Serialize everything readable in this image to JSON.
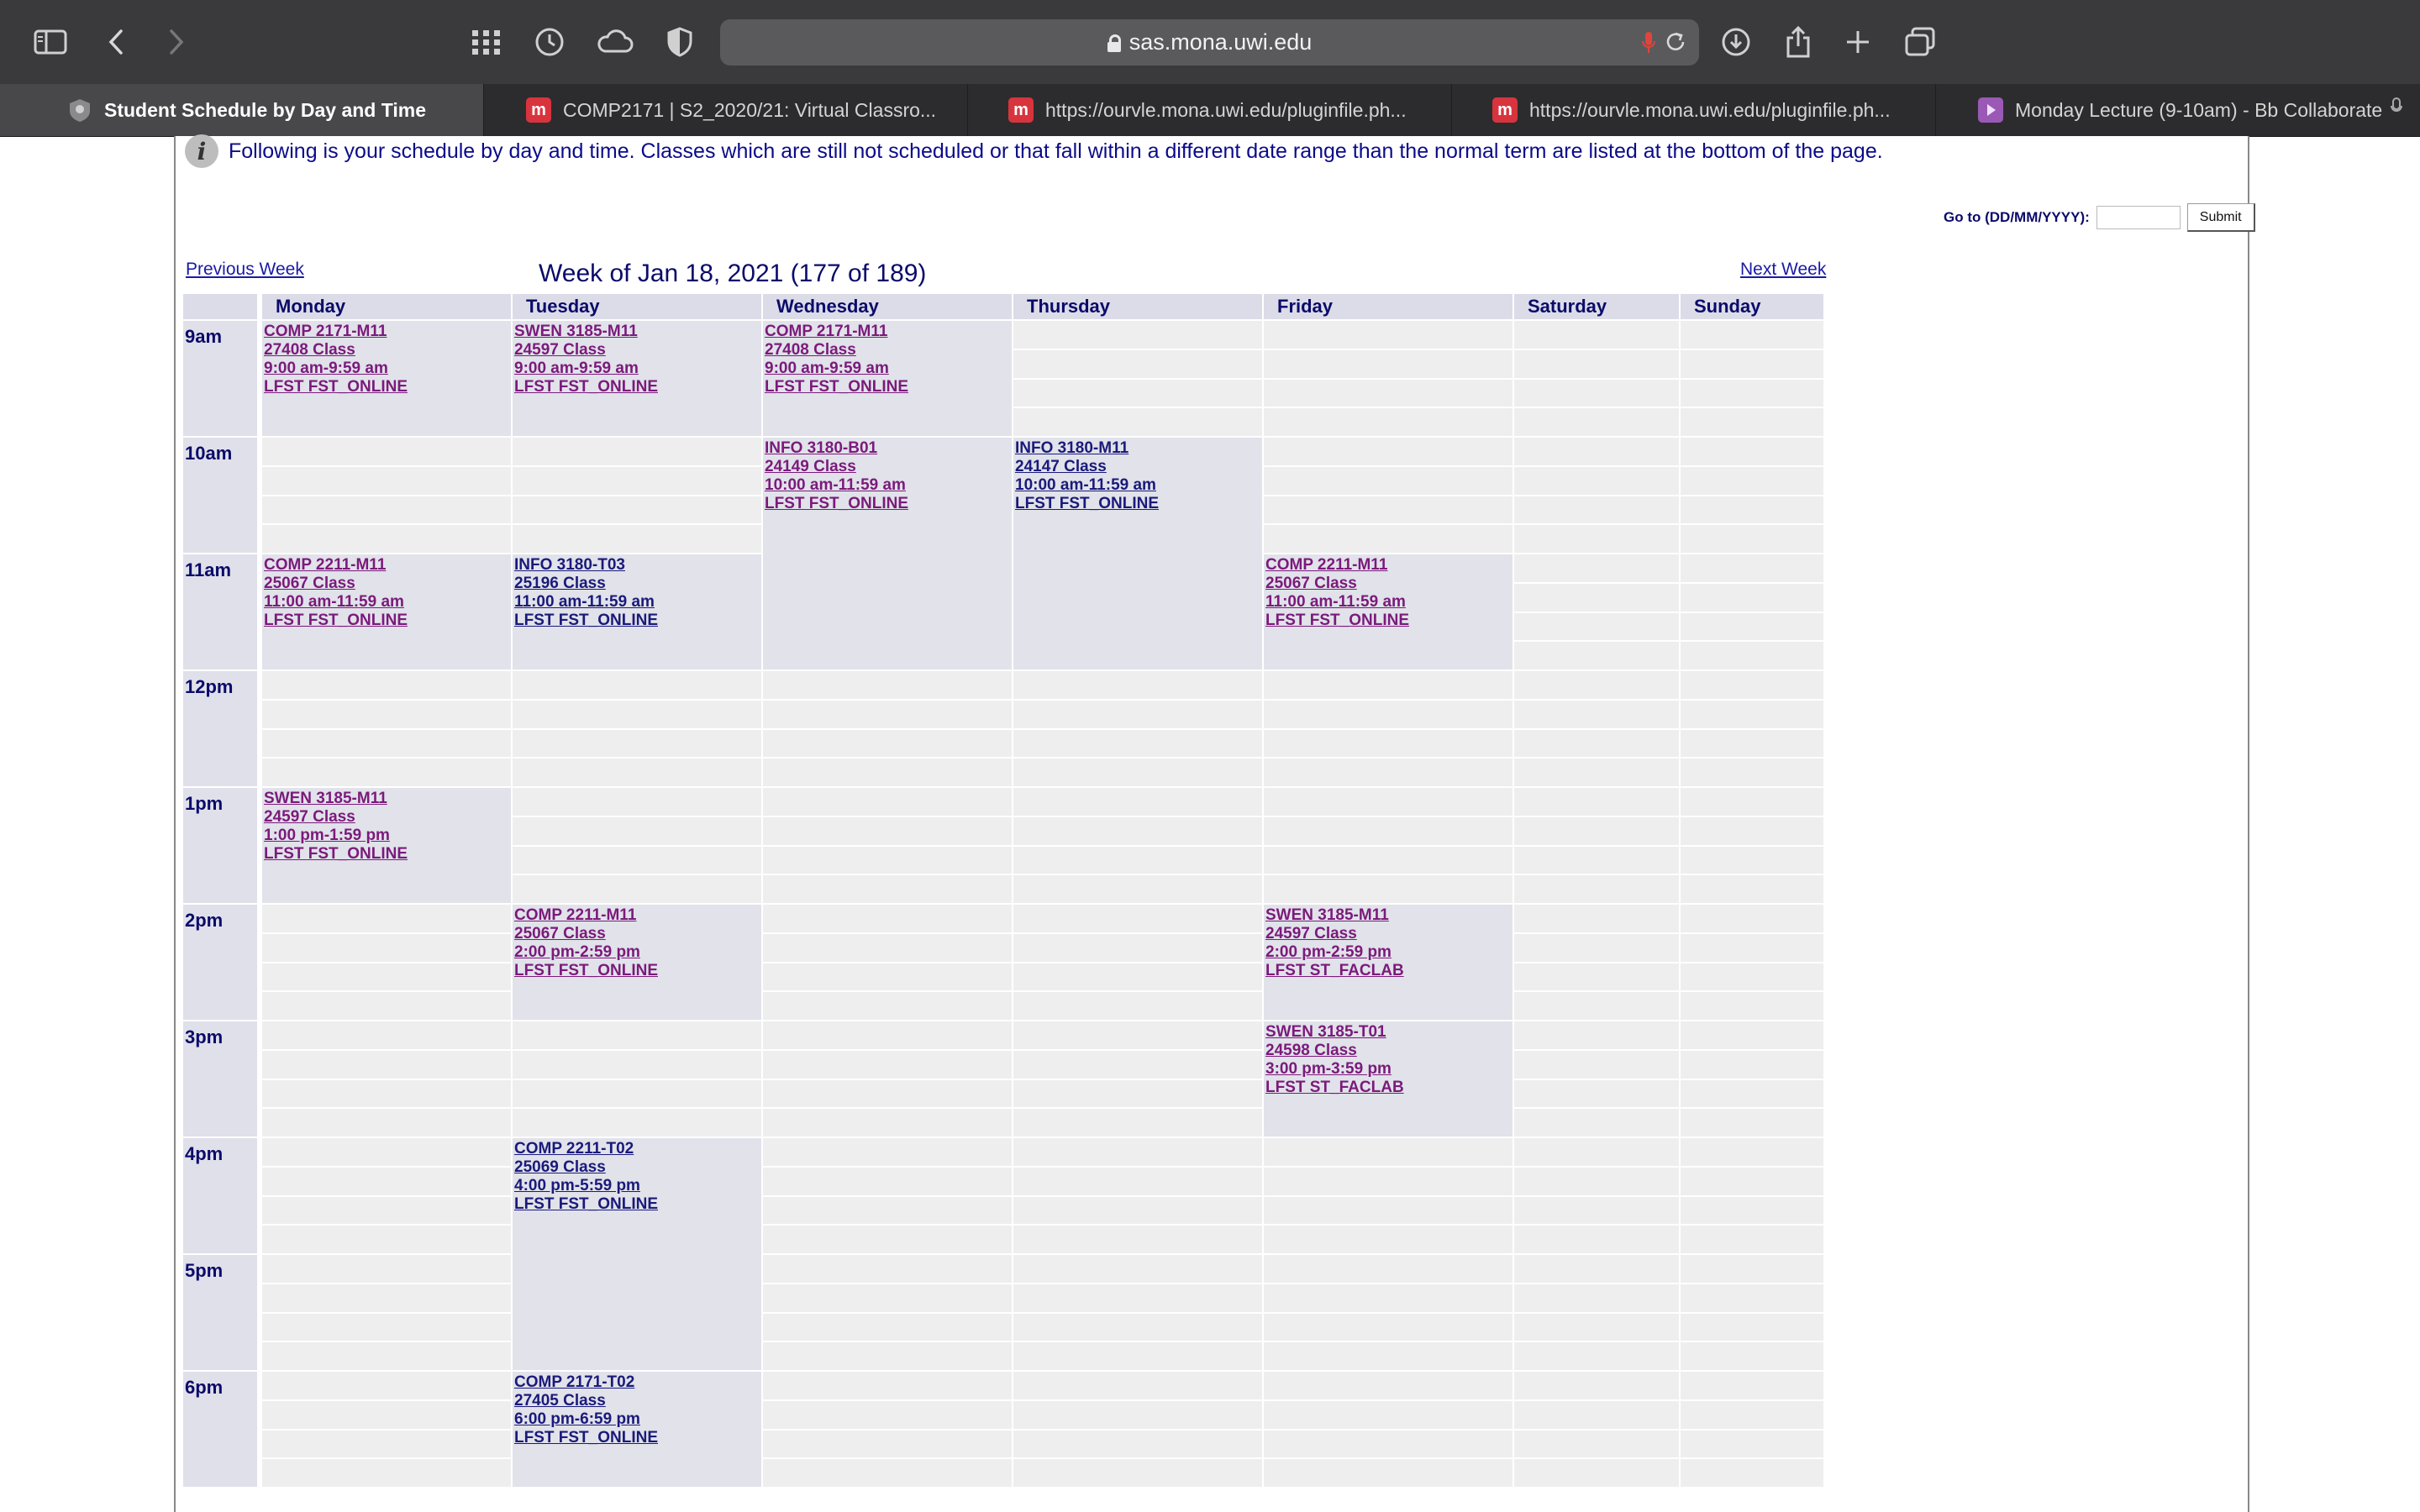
{
  "browser": {
    "url": "sas.mona.uwi.edu",
    "tabs": [
      {
        "label": "Student Schedule by Day and Time",
        "icon": "uwi-crest-icon",
        "active": true
      },
      {
        "label": "COMP2171 | S2_2020/21: Virtual Classro...",
        "icon": "moodle-icon",
        "active": false
      },
      {
        "label": "https://ourvle.mona.uwi.edu/pluginfile.ph...",
        "icon": "moodle-icon",
        "active": false
      },
      {
        "label": "https://ourvle.mona.uwi.edu/pluginfile.ph...",
        "icon": "moodle-icon",
        "active": false
      },
      {
        "label": "Monday Lecture (9-10am) - Bb Collaborate",
        "icon": "bb-collaborate-icon",
        "active": false
      }
    ]
  },
  "page": {
    "info_text": "Following is your schedule by day and time. Classes which are still not scheduled or that fall within a different date range than the normal term are listed at the bottom of the page.",
    "goto_label": "Go to (DD/MM/YYYY):",
    "goto_value": "",
    "submit_label": "Submit",
    "prev_week": "Previous Week",
    "next_week": "Next Week",
    "week_title": "Week of Jan 18, 2021 (177 of 189)"
  },
  "schedule": {
    "days": [
      "Monday",
      "Tuesday",
      "Wednesday",
      "Thursday",
      "Friday",
      "Saturday",
      "Sunday"
    ],
    "hours": [
      "9am",
      "10am",
      "11am",
      "12pm",
      "1pm",
      "2pm",
      "3pm",
      "4pm",
      "5pm",
      "6pm"
    ],
    "events": [
      {
        "day": 0,
        "start": 0,
        "quarters": 4,
        "color": "purple",
        "lines": [
          "COMP 2171-M11",
          "27408 Class",
          "9:00 am-9:59 am",
          "LFST FST_ONLINE"
        ]
      },
      {
        "day": 1,
        "start": 0,
        "quarters": 4,
        "color": "purple",
        "lines": [
          "SWEN 3185-M11",
          "24597 Class",
          "9:00 am-9:59 am",
          "LFST FST_ONLINE"
        ]
      },
      {
        "day": 2,
        "start": 0,
        "quarters": 4,
        "color": "purple",
        "lines": [
          "COMP 2171-M11",
          "27408 Class",
          "9:00 am-9:59 am",
          "LFST FST_ONLINE"
        ]
      },
      {
        "day": 2,
        "start": 4,
        "quarters": 8,
        "color": "purple",
        "lines": [
          "INFO 3180-B01",
          "24149 Class",
          "10:00 am-11:59 am",
          "LFST FST_ONLINE"
        ]
      },
      {
        "day": 3,
        "start": 4,
        "quarters": 8,
        "color": "blue",
        "lines": [
          "INFO 3180-M11",
          "24147 Class",
          "10:00 am-11:59 am",
          "LFST FST_ONLINE"
        ]
      },
      {
        "day": 0,
        "start": 8,
        "quarters": 4,
        "color": "purple",
        "lines": [
          "COMP 2211-M11",
          "25067 Class",
          "11:00 am-11:59 am",
          "LFST FST_ONLINE"
        ]
      },
      {
        "day": 1,
        "start": 8,
        "quarters": 4,
        "color": "blue",
        "lines": [
          "INFO 3180-T03",
          "25196 Class",
          "11:00 am-11:59 am",
          "LFST FST_ONLINE"
        ]
      },
      {
        "day": 4,
        "start": 8,
        "quarters": 4,
        "color": "purple",
        "lines": [
          "COMP 2211-M11",
          "25067 Class",
          "11:00 am-11:59 am",
          "LFST FST_ONLINE"
        ]
      },
      {
        "day": 0,
        "start": 16,
        "quarters": 4,
        "color": "purple",
        "lines": [
          "SWEN 3185-M11",
          "24597 Class",
          "1:00 pm-1:59 pm",
          "LFST FST_ONLINE"
        ]
      },
      {
        "day": 1,
        "start": 20,
        "quarters": 4,
        "color": "purple",
        "lines": [
          "COMP 2211-M11",
          "25067 Class",
          "2:00 pm-2:59 pm",
          "LFST FST_ONLINE"
        ]
      },
      {
        "day": 4,
        "start": 20,
        "quarters": 4,
        "color": "purple",
        "lines": [
          "SWEN 3185-M11",
          "24597 Class",
          "2:00 pm-2:59 pm",
          "LFST ST_FACLAB"
        ]
      },
      {
        "day": 4,
        "start": 24,
        "quarters": 4,
        "color": "purple",
        "lines": [
          "SWEN 3185-T01",
          "24598 Class",
          "3:00 pm-3:59 pm",
          "LFST ST_FACLAB"
        ]
      },
      {
        "day": 1,
        "start": 28,
        "quarters": 8,
        "color": "blue",
        "lines": [
          "COMP 2211-T02",
          "25069 Class",
          "4:00 pm-5:59 pm",
          "LFST FST_ONLINE"
        ]
      },
      {
        "day": 1,
        "start": 36,
        "quarters": 4,
        "color": "blue",
        "lines": [
          "COMP 2171-T02",
          "27405 Class",
          "6:00 pm-6:59 pm",
          "LFST FST_ONLINE"
        ]
      }
    ]
  }
}
